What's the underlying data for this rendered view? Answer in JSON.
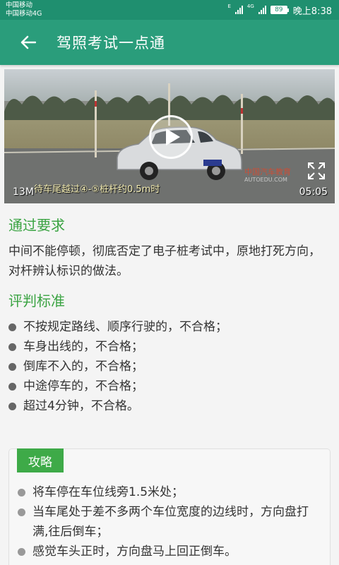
{
  "status_bar": {
    "carrier1": "中国移动",
    "carrier2": "中国移动4G",
    "net_e": "E",
    "net_4g": "4G",
    "battery": "89",
    "time": "晚上8:38"
  },
  "app_bar": {
    "title": "驾照考试一点通",
    "back_icon": "arrow-left-icon"
  },
  "video": {
    "size": "13M",
    "duration": "05:05",
    "subtitle": "待车尾越过④-⑤桩杆约0.5m时",
    "watermark": "中国汽车教育",
    "watermark_sub": "AUTOEDU.COM",
    "play_icon": "play-icon",
    "fullscreen_icon": "fullscreen-icon"
  },
  "pass_requirement": {
    "title": "通过要求",
    "text": "中间不能停顿，彻底否定了电子桩考试中，原地打死方向，对杆辨认标识的做法。"
  },
  "criteria": {
    "title": "评判标准",
    "items": [
      "不按规定路线、顺序行驶的，不合格；",
      "车身出线的，不合格；",
      "倒库不入的，不合格；",
      "中途停车的，不合格；",
      "超过4分钟，不合格。"
    ]
  },
  "strategy": {
    "tag": "攻略",
    "items": [
      "将车停在车位线旁1.5米处；",
      "当车尾处于差不多两个车位宽度的边线时，方向盘打满,往后倒车；",
      "感觉车头正时，方向盘马上回正倒车。"
    ]
  },
  "colors": {
    "status_bar": "#1f8f6f",
    "app_bar": "#2a9d7b",
    "accent_green": "#3aa342",
    "tag_green": "#3eaa48"
  }
}
